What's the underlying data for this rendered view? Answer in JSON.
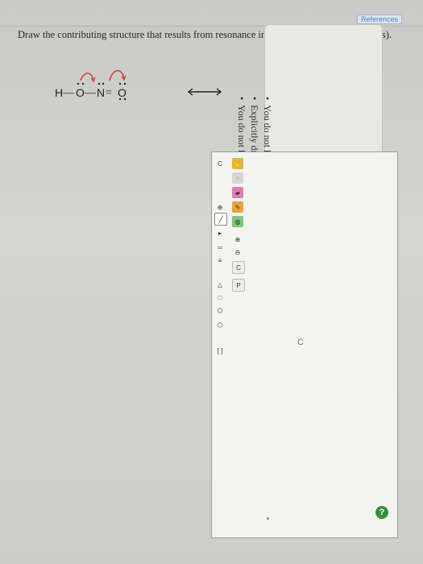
{
  "header": {
    "references_label": "References"
  },
  "question": {
    "text": "Draw the contributing structure that results from resonance indicated by the curved arrow(s)."
  },
  "molecule": {
    "atoms": [
      "H",
      "O",
      "N",
      "O"
    ],
    "bonds": [
      "—",
      "—",
      "="
    ]
  },
  "instructions": {
    "items": [
      "You do not have to consider stereochemistry.",
      "Explicitly draw all H atoms.",
      "You do not have to include lone pairs in your answer."
    ]
  },
  "editor": {
    "canvas_label": "C",
    "help_label": "?",
    "toolbar_icons": [
      "hand-icon",
      "lasso-icon",
      "eraser-icon",
      "pencil-icon",
      "ring-icon",
      "zoom-in-icon",
      "zoom-out-icon",
      "c-icon",
      "p-icon"
    ],
    "atom_label": "C",
    "charge_label": "⊕",
    "ring_shapes": [
      "triangle",
      "square",
      "pentagon",
      "hexagon"
    ]
  },
  "colors": {
    "accent": "#4a7ec2",
    "help": "#3a8e3a",
    "curved_arrow": "#d0453a"
  }
}
